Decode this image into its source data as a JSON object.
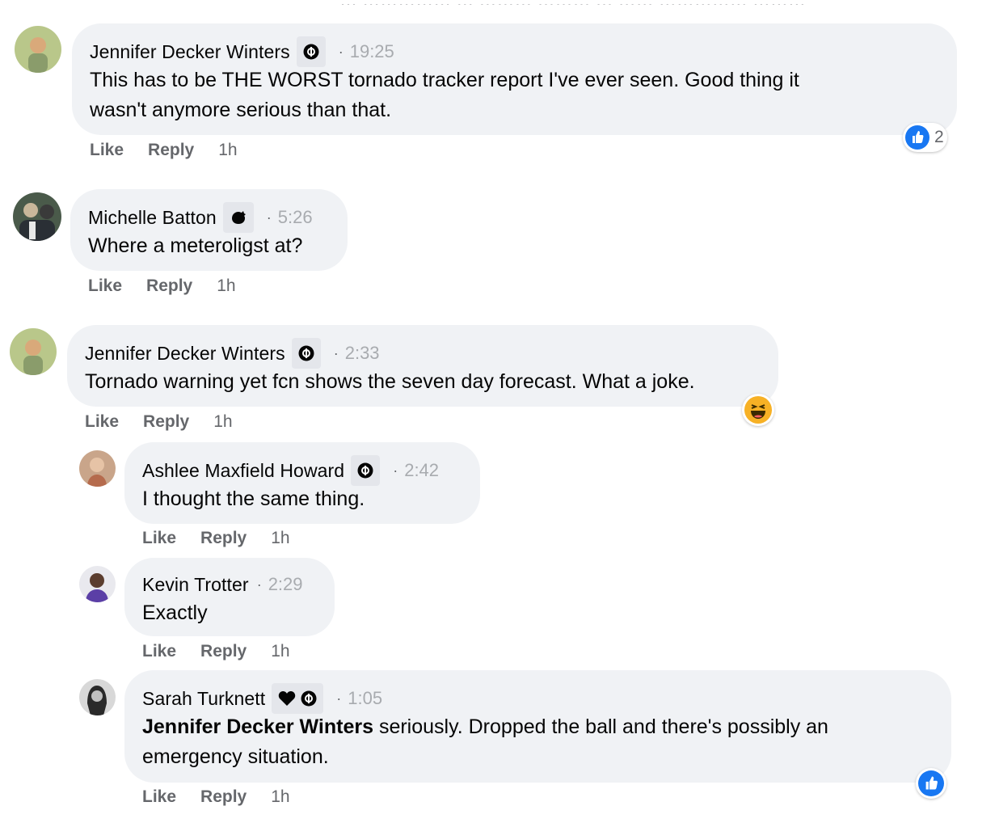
{
  "top_text": "… …………… … ……… ……… … …… …………… ………",
  "comments": [
    {
      "author": "Jennifer Decker Winters",
      "time": "19:25",
      "text_lines": [
        "This has to be THE WORST tornado tracker report I've ever seen. Good thing it",
        "wasn't anymore serious than that."
      ],
      "like": "Like",
      "reply": "Reply",
      "ago": "1h",
      "reaction_count": "2"
    },
    {
      "author": "Michelle Batton",
      "time": "5:26",
      "text_lines": [
        "Where a meteroligst at?"
      ],
      "like": "Like",
      "reply": "Reply",
      "ago": "1h"
    },
    {
      "author": "Jennifer Decker Winters",
      "time": "2:33",
      "text_lines": [
        "Tornado warning yet fcn shows the seven day forecast. What a joke."
      ],
      "like": "Like",
      "reply": "Reply",
      "ago": "1h"
    },
    {
      "author": "Ashlee Maxfield Howard",
      "time": "2:42",
      "text_lines": [
        "I thought the same thing."
      ],
      "like": "Like",
      "reply": "Reply",
      "ago": "1h"
    },
    {
      "author": "Kevin Trotter",
      "time": "2:29",
      "text_lines": [
        "Exactly"
      ],
      "like": "Like",
      "reply": "Reply",
      "ago": "1h"
    },
    {
      "author": "Sarah Turknett",
      "time": "1:05",
      "mention": "Jennifer Decker Winters",
      "text_rest_line1": " seriously. Dropped the ball and there's possibly an",
      "text_line2": "emergency situation.",
      "like": "Like",
      "reply": "Reply",
      "ago": "1h"
    }
  ],
  "colors": {
    "bubble": "#f0f2f5",
    "badge": "#e4e6eb",
    "like_blue": "#1877f2",
    "haha_yellow": "#f7b125",
    "muted": "#65676b"
  },
  "icons": [
    "fan-badge-icon",
    "like-reaction-icon",
    "haha-reaction-icon",
    "heart-icon"
  ]
}
